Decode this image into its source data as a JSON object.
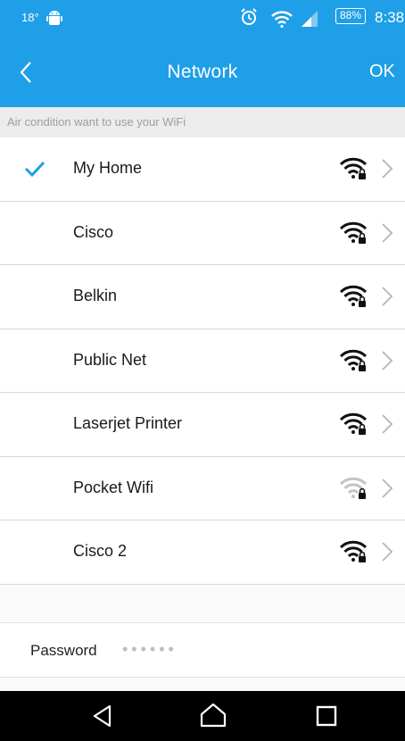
{
  "status_bar": {
    "temperature": "18°",
    "battery": "88%",
    "time": "8:38",
    "icons": [
      "android-icon",
      "alarm-icon",
      "wifi-status-icon",
      "signal-icon",
      "battery-icon"
    ]
  },
  "header": {
    "title": "Network",
    "ok_label": "OK",
    "background_color": "#1e9fe8"
  },
  "section_hint": "Air condition want to use your WiFi",
  "networks": [
    {
      "name": "My Home",
      "selected": true,
      "signal": "strong",
      "secured": true
    },
    {
      "name": "Cisco",
      "selected": false,
      "signal": "strong",
      "secured": true
    },
    {
      "name": "Belkin",
      "selected": false,
      "signal": "strong",
      "secured": true
    },
    {
      "name": "Public Net",
      "selected": false,
      "signal": "strong",
      "secured": true
    },
    {
      "name": "Laserjet Printer",
      "selected": false,
      "signal": "strong",
      "secured": true
    },
    {
      "name": "Pocket Wifi",
      "selected": false,
      "signal": "weak",
      "secured": true
    },
    {
      "name": "Cisco 2",
      "selected": false,
      "signal": "strong",
      "secured": true
    }
  ],
  "password": {
    "label": "Password",
    "value": "••••••"
  },
  "nav_bar": {
    "icons": [
      "back-triangle-icon",
      "home-icon",
      "recents-icon"
    ]
  },
  "colors": {
    "accent": "#1e9fe8",
    "check": "#1e9fe8",
    "wifi_strong": "#111111",
    "wifi_weak": "#c4c4c4"
  }
}
